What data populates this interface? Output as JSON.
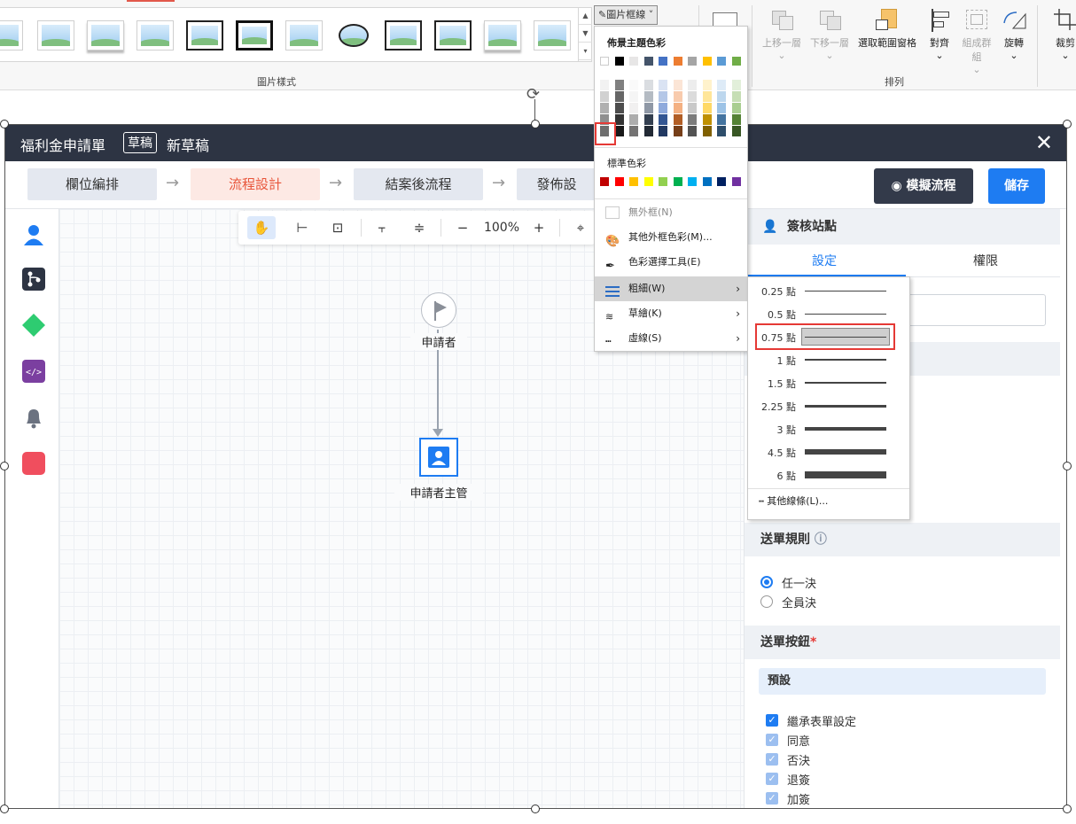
{
  "ribbon": {
    "group_picture_styles": "圖片樣式",
    "group_arrange": "排列",
    "picture_border_btn": "圖片框線",
    "bring_forward": "上移一層",
    "send_backward": "下移一層",
    "selection_pane": "選取範圍窗格",
    "align": "對齊",
    "group": "組成群組",
    "rotate": "旋轉",
    "crop": "裁剪"
  },
  "color_menu": {
    "theme_colors_header": "佈景主題色彩",
    "standard_colors_header": "標準色彩",
    "no_outline": "無外框(N)",
    "more_colors": "其他外框色彩(M)...",
    "eyedropper": "色彩選擇工具(E)",
    "weight": "粗細(W)",
    "sketched": "草繪(K)",
    "dashes": "虛線(S)",
    "theme_row": [
      "#ffffff",
      "#000000",
      "#e7e6e6",
      "#44546a",
      "#4472c4",
      "#ed7d31",
      "#a5a5a5",
      "#ffc000",
      "#5b9bd5",
      "#70ad47"
    ],
    "standard_row": [
      "#c00000",
      "#ff0000",
      "#ffc000",
      "#ffff00",
      "#92d050",
      "#00b050",
      "#00b0f0",
      "#0070c0",
      "#002060",
      "#7030a0"
    ]
  },
  "weight_menu": {
    "items": [
      "0.25 點",
      "0.5 點",
      "0.75 點",
      "1 點",
      "1.5 點",
      "2.25 點",
      "3 點",
      "4.5 點",
      "6 點"
    ],
    "more_lines": "其他線條(L)...",
    "selected": "0.75 點"
  },
  "app": {
    "title": "福利金申請單",
    "badge": "草稿",
    "subtitle": "新草稿",
    "close": "✕",
    "steps": [
      "欄位編排",
      "流程設計",
      "結案後流程",
      "發佈設"
    ],
    "simulate_btn": "模擬流程",
    "save_btn": "儲存",
    "zoom": "100%",
    "zoom_minus": "−",
    "zoom_plus": "+",
    "node_start": "申請者",
    "node_manager": "申請者主管"
  },
  "panel": {
    "header": "簽核站點",
    "tab_settings": "設定",
    "tab_permission": "權限",
    "send_rule": "送單規則",
    "rule_options": [
      "任一決",
      "全員決"
    ],
    "send_buttons": "送單按鈕",
    "required_mark": "*",
    "preset": "預設",
    "checks": [
      "繼承表單設定",
      "同意",
      "否決",
      "退簽",
      "加簽"
    ]
  }
}
